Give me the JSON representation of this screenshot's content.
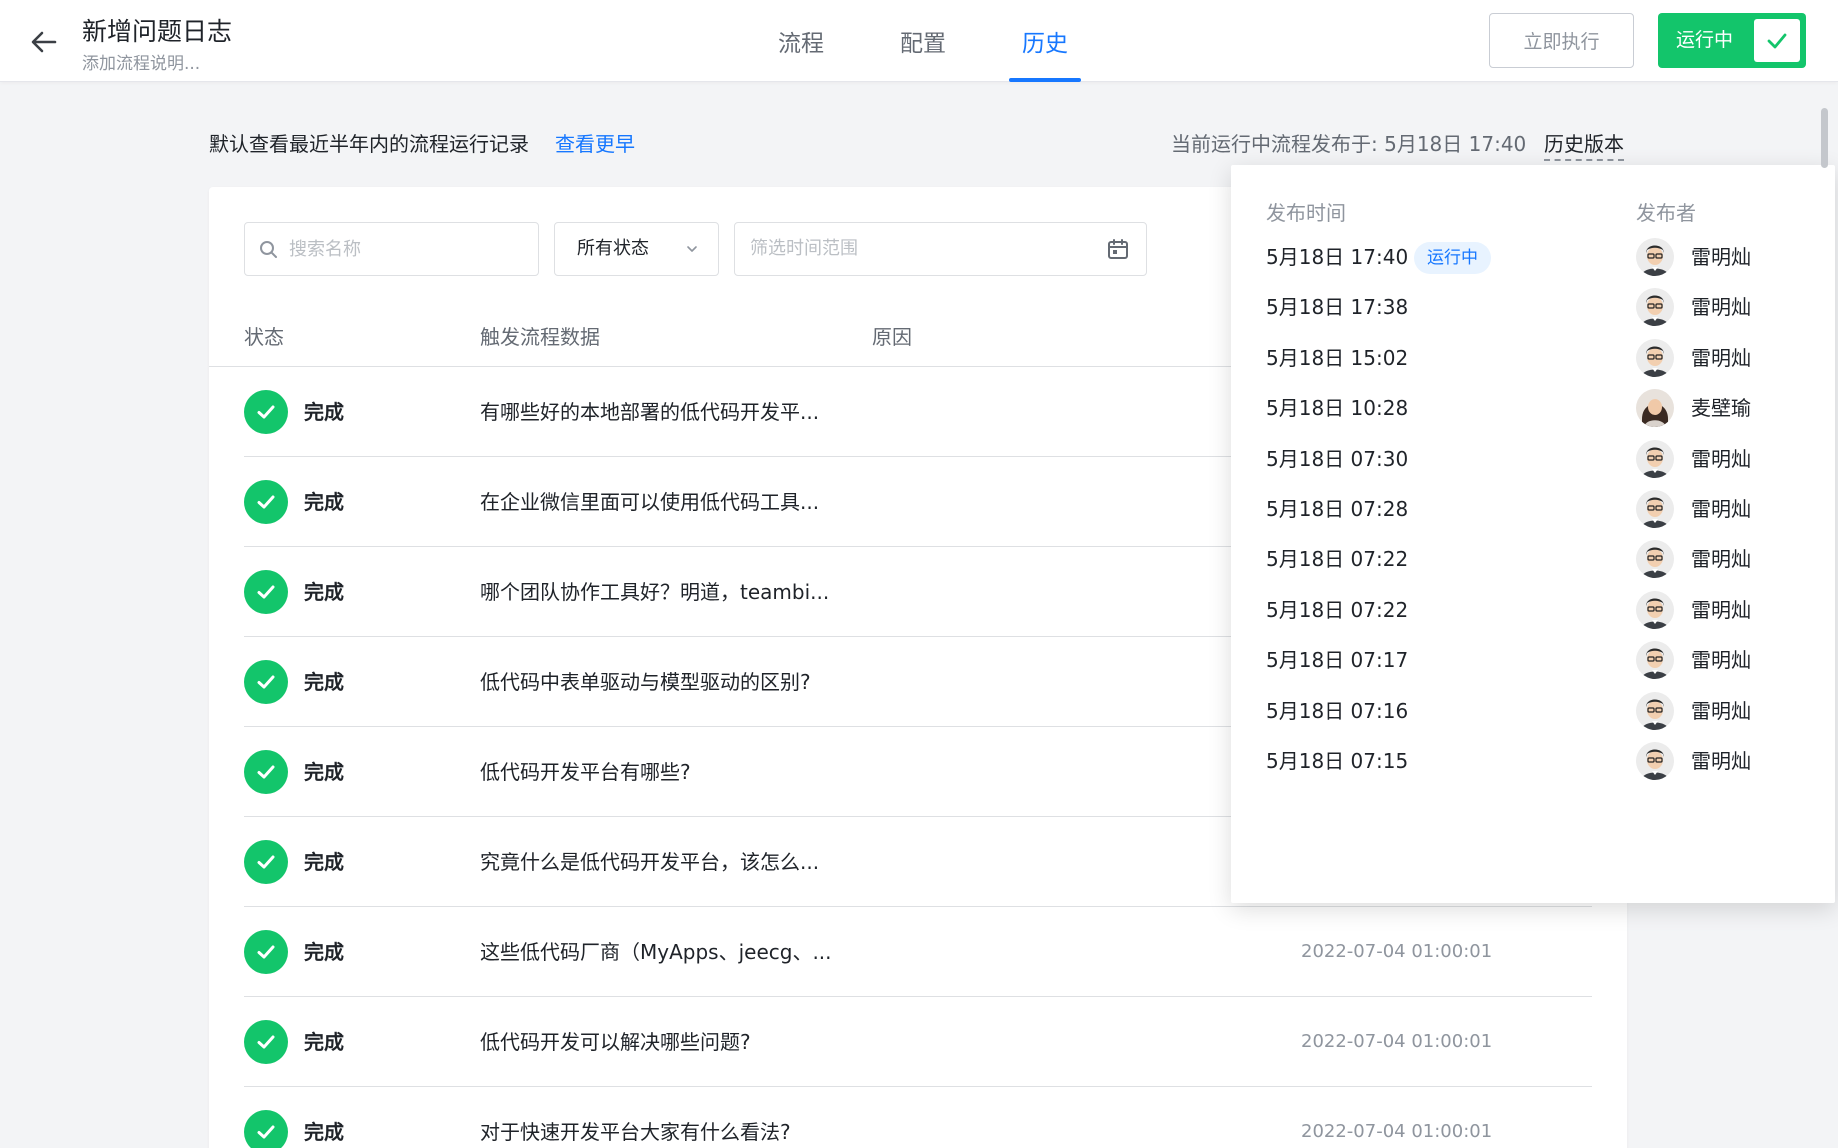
{
  "header": {
    "title": "新增问题日志",
    "subtitle": "添加流程说明...",
    "tabs": [
      {
        "label": "流程"
      },
      {
        "label": "配置"
      },
      {
        "label": "历史"
      }
    ],
    "exec_button": "立即执行",
    "run_toggle": "运行中"
  },
  "info": {
    "left_text": "默认查看最近半年内的流程运行记录",
    "link_text": "查看更早",
    "current_text": "当前运行中流程发布于: 5月18日 17:40",
    "history_version": "历史版本"
  },
  "filters": {
    "search_placeholder": "搜索名称",
    "status_value": "所有状态",
    "date_placeholder": "筛选时间范围"
  },
  "table": {
    "headers": {
      "status": "状态",
      "trigger": "触发流程数据",
      "reason": "原因"
    },
    "rows": [
      {
        "status": "完成",
        "trigger": "有哪些好的本地部署的低代码开发平...",
        "time": ""
      },
      {
        "status": "完成",
        "trigger": "在企业微信里面可以使用低代码工具...",
        "time": ""
      },
      {
        "status": "完成",
        "trigger": "哪个团队协作工具好？明道，teambi...",
        "time": ""
      },
      {
        "status": "完成",
        "trigger": "低代码中表单驱动与模型驱动的区别?",
        "time": ""
      },
      {
        "status": "完成",
        "trigger": "低代码开发平台有哪些?",
        "time": ""
      },
      {
        "status": "完成",
        "trigger": "究竟什么是低代码开发平台，该怎么...",
        "time": ""
      },
      {
        "status": "完成",
        "trigger": "这些低代码厂商（MyApps、jeecg、...",
        "time": "2022-07-04 01:00:01"
      },
      {
        "status": "完成",
        "trigger": "低代码开发可以解决哪些问题?",
        "time": "2022-07-04 01:00:01"
      },
      {
        "status": "完成",
        "trigger": "对于快速开发平台大家有什么看法?",
        "time": "2022-07-04 01:00:01"
      }
    ]
  },
  "popover": {
    "header_time": "发布时间",
    "header_publisher": "发布者",
    "running_badge": "运行中",
    "rows": [
      {
        "time": "5月18日 17:40",
        "publisher": "雷明灿",
        "avatar": "male",
        "running": true
      },
      {
        "time": "5月18日 17:38",
        "publisher": "雷明灿",
        "avatar": "male",
        "running": false
      },
      {
        "time": "5月18日 15:02",
        "publisher": "雷明灿",
        "avatar": "male",
        "running": false
      },
      {
        "time": "5月18日 10:28",
        "publisher": "麦壁瑜",
        "avatar": "female",
        "running": false
      },
      {
        "time": "5月18日 07:30",
        "publisher": "雷明灿",
        "avatar": "male",
        "running": false
      },
      {
        "time": "5月18日 07:28",
        "publisher": "雷明灿",
        "avatar": "male",
        "running": false
      },
      {
        "time": "5月18日 07:22",
        "publisher": "雷明灿",
        "avatar": "male",
        "running": false
      },
      {
        "time": "5月18日 07:22",
        "publisher": "雷明灿",
        "avatar": "male",
        "running": false
      },
      {
        "time": "5月18日 07:17",
        "publisher": "雷明灿",
        "avatar": "male",
        "running": false
      },
      {
        "time": "5月18日 07:16",
        "publisher": "雷明灿",
        "avatar": "male",
        "running": false
      },
      {
        "time": "5月18日 07:15",
        "publisher": "雷明灿",
        "avatar": "male",
        "running": false
      }
    ]
  },
  "colors": {
    "primary": "#1677ff",
    "success": "#13c56b",
    "text": "#1f2329",
    "muted": "#8f959e",
    "badge_bg": "#e8f3ff"
  },
  "icons": {
    "back": "arrow-left-icon",
    "search": "search-icon",
    "dropdown": "chevron-down-icon",
    "calendar": "calendar-icon",
    "status": "check-circle-icon",
    "toggle": "check-icon"
  }
}
